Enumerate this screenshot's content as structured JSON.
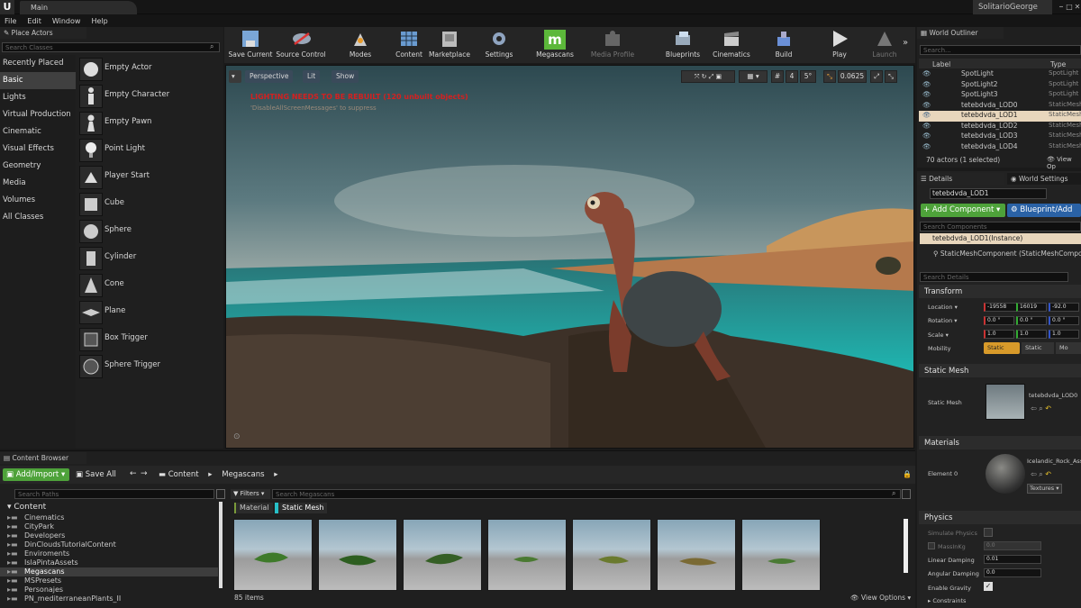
{
  "window": {
    "logo": "U",
    "tab": "Main",
    "user": "SolitarioGeorge",
    "controls": [
      "–",
      "□",
      "✕"
    ]
  },
  "menu": [
    "File",
    "Edit",
    "Window",
    "Help"
  ],
  "place_actors": {
    "title": "Place Actors",
    "search_placeholder": "Search Classes",
    "categories": [
      "Recently Placed",
      "Basic",
      "Lights",
      "Virtual Production",
      "Cinematic",
      "Visual Effects",
      "Geometry",
      "Media",
      "Volumes",
      "All Classes"
    ],
    "selected_category": "Basic",
    "actors": [
      "Empty Actor",
      "Empty Character",
      "Empty Pawn",
      "Point Light",
      "Player Start",
      "Cube",
      "Sphere",
      "Cylinder",
      "Cone",
      "Plane",
      "Box Trigger",
      "Sphere Trigger"
    ]
  },
  "toolbar": [
    "Save Current",
    "Source Control",
    "Modes",
    "Content",
    "Marketplace",
    "Settings",
    "Megascans",
    "Media Profile",
    "Blueprints",
    "Cinematics",
    "Build",
    "Play",
    "Launch"
  ],
  "viewport": {
    "perspective": "Perspective",
    "lit": "Lit",
    "show": "Show",
    "warning": "LIGHTING NEEDS TO BE REBUILT (120 unbuilt objects)",
    "warning_sub": "'DisableAllScreenMessages' to suppress",
    "snap_angle": "5°",
    "camera_speed": "0.0625",
    "grid_count": "4"
  },
  "world_outliner": {
    "title": "World Outliner",
    "search_placeholder": "Search...",
    "col_label": "Label",
    "col_type": "Type",
    "rows": [
      {
        "label": "SpotLight",
        "type": "SpotLight"
      },
      {
        "label": "SpotLight2",
        "type": "SpotLight"
      },
      {
        "label": "SpotLight3",
        "type": "SpotLight"
      },
      {
        "label": "tetebdvda_LOD0",
        "type": "StaticMesh"
      },
      {
        "label": "tetebdvda_LOD1",
        "type": "StaticMesh"
      },
      {
        "label": "tetebdvda_LOD2",
        "type": "StaticMesh"
      },
      {
        "label": "tetebdvda_LOD3",
        "type": "StaticMesh"
      },
      {
        "label": "tetebdvda_LOD4",
        "type": "StaticMesh"
      }
    ],
    "selected_row": 4,
    "status": "70 actors (1 selected)",
    "view_options": "View Op"
  },
  "details": {
    "tab": "Details",
    "tab2": "World Settings",
    "name": "tetebdvda_LOD1",
    "add_component": "+ Add Component ▾",
    "blueprint_add": "Blueprint/Add",
    "search_components": "Search Components",
    "instance": "tetebdvda_LOD1(Instance)",
    "component": "StaticMeshComponent (StaticMeshCompon",
    "search_details": "Search Details",
    "transform_title": "Transform",
    "location_label": "Location",
    "rotation_label": "Rotation",
    "scale_label": "Scale",
    "mobility_label": "Mobility",
    "location": [
      "-19558",
      "16019",
      "-92.0"
    ],
    "rotation": [
      "0.0 °",
      "0.0 °",
      "0.0 °"
    ],
    "scale": [
      "1.0",
      "1.0",
      "1.0"
    ],
    "mobility": [
      "Static",
      "Static",
      "Mo"
    ],
    "static_mesh_title": "Static Mesh",
    "static_mesh_label": "Static Mesh",
    "static_mesh_value": "tetebdvda_LOD0",
    "materials_title": "Materials",
    "element_label": "Element 0",
    "element_value": "Icelandic_Rock_Ass",
    "textures_label": "Textures ▾",
    "physics_title": "Physics",
    "simulate_label": "Simulate Physics",
    "mass_label": "MassInKg",
    "mass_value": "0.0",
    "linear_damping_label": "Linear Damping",
    "linear_damping": "0.01",
    "angular_damping_label": "Angular Damping",
    "angular_damping": "0.0",
    "gravity_label": "Enable Gravity",
    "constraints_label": "Constraints"
  },
  "content_browser": {
    "title": "Content Browser",
    "add_import": "Add/Import ▾",
    "save_all": "Save All",
    "path": [
      "Content",
      "Megascans"
    ],
    "search_paths": "Search Paths",
    "filters": "Filters ▾",
    "search_assets": "Search Megascans",
    "filter_chips": [
      "Material",
      "Static Mesh"
    ],
    "tree_root": "Content",
    "tree": [
      "Cinematics",
      "CityPark",
      "Developers",
      "DinCloudsTutorialContent",
      "Enviroments",
      "IslaPintaAssets",
      "Megascans",
      "MSPresets",
      "Personajes",
      "PN_mediterraneanPlants_II"
    ],
    "tree_selected": "Megascans",
    "item_count": "85 items",
    "view_options": "View Options ▾"
  },
  "colors": {
    "accent_green": "#4ea23a",
    "accent_blue": "#2a62a6",
    "warning_red": "#d42020",
    "selection": "#404040"
  }
}
